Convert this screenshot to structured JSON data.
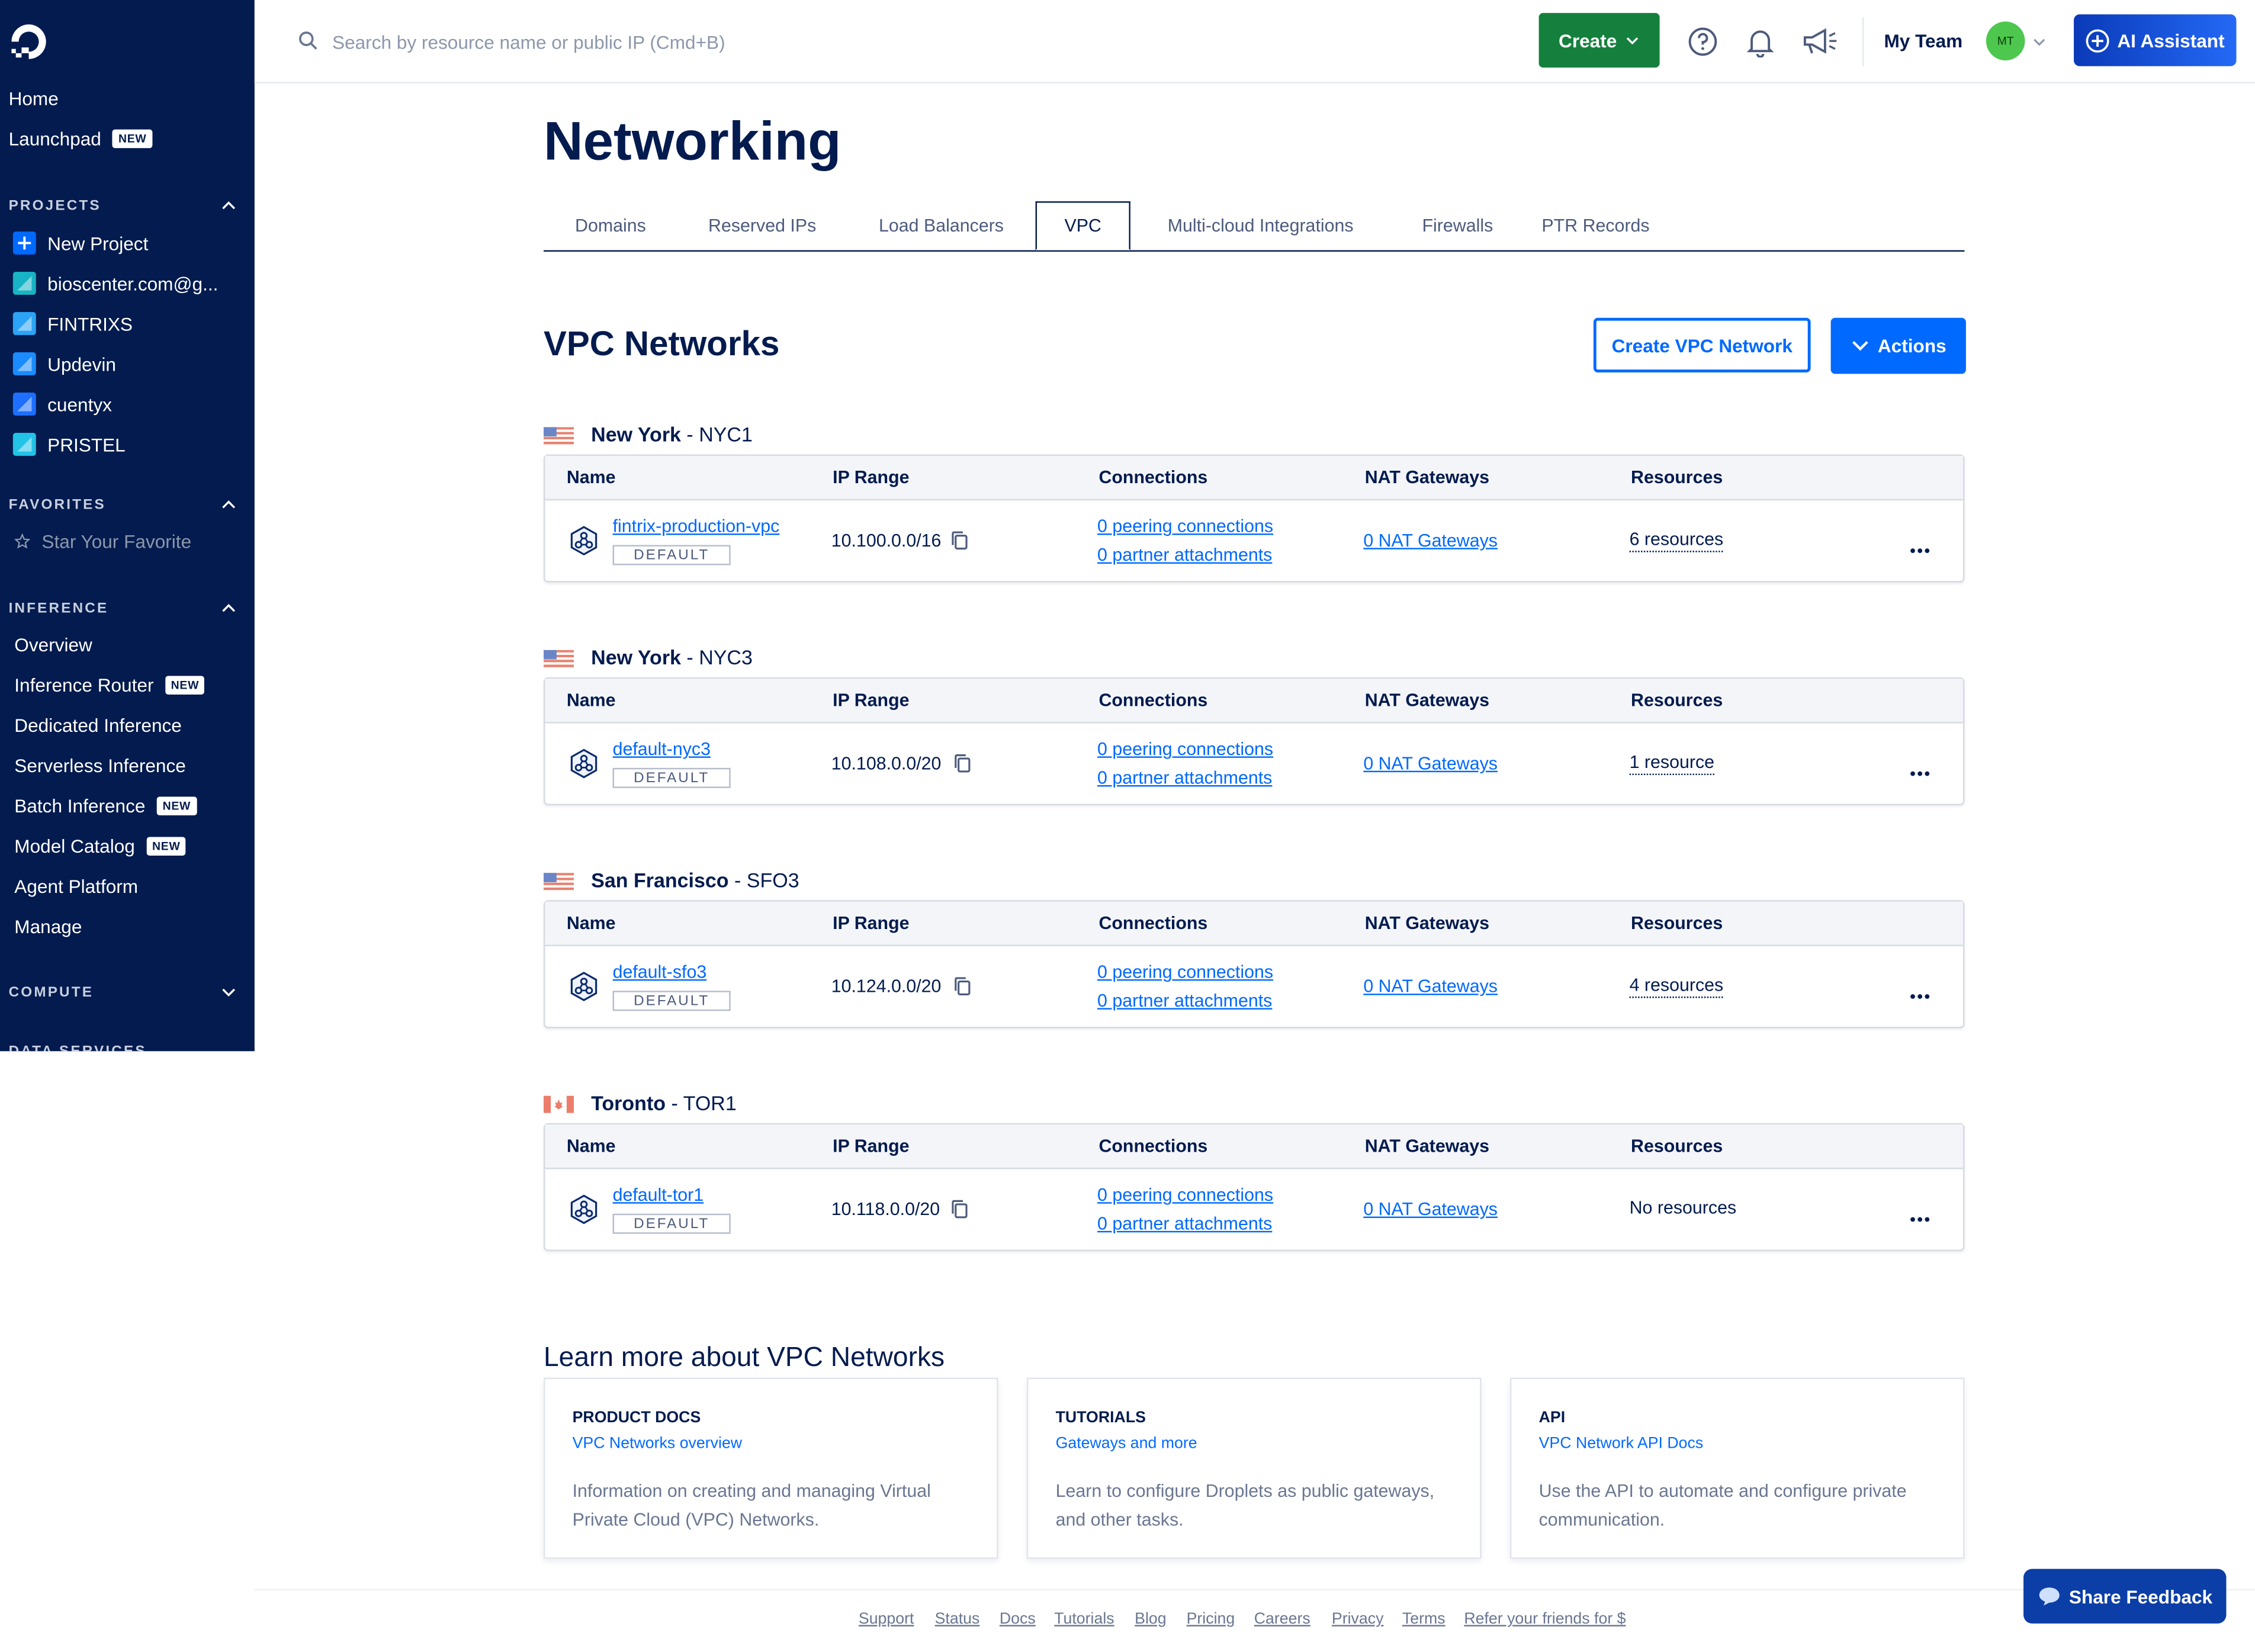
{
  "sidebar": {
    "home": "Home",
    "launchpad": "Launchpad",
    "new_badge": "NEW",
    "projects_header": "PROJECTS",
    "projects": [
      {
        "label": "New Project",
        "color": "#0069ff"
      },
      {
        "label": "bioscenter.com@g...",
        "color": "#18b3c4"
      },
      {
        "label": "FINTRIXS",
        "color": "#2ba4f5"
      },
      {
        "label": "Updevin",
        "color": "#1a8cff"
      },
      {
        "label": "cuentyx",
        "color": "#1e6fff"
      },
      {
        "label": "PRISTEL",
        "color": "#22c3e6"
      }
    ],
    "favorites_header": "FAVORITES",
    "star_favorite": "Star Your Favorite",
    "inference_header": "INFERENCE",
    "inference_items": [
      {
        "label": "Overview",
        "badge": ""
      },
      {
        "label": "Inference Router",
        "badge": "NEW"
      },
      {
        "label": "Dedicated Inference",
        "badge": ""
      },
      {
        "label": "Serverless Inference",
        "badge": ""
      },
      {
        "label": "Batch Inference",
        "badge": "NEW"
      },
      {
        "label": "Model Catalog",
        "badge": "NEW"
      },
      {
        "label": "Agent Platform",
        "badge": ""
      },
      {
        "label": "Manage",
        "badge": ""
      }
    ],
    "compute_header": "COMPUTE",
    "data_services_header": "DATA SERVICES"
  },
  "topbar": {
    "search_placeholder": "Search by resource name or public IP (Cmd+B)",
    "create_label": "Create",
    "team_label": "My Team",
    "avatar_initials": "MT",
    "ai_label": "AI Assistant"
  },
  "main": {
    "title": "Networking",
    "tabs": [
      "Domains",
      "Reserved IPs",
      "Load Balancers",
      "VPC",
      "Multi-cloud Integrations",
      "Firewalls",
      "PTR Records"
    ],
    "active_tab": "VPC",
    "section_title": "VPC Networks",
    "create_vpc_label": "Create VPC Network",
    "actions_label": "Actions",
    "columns": [
      "Name",
      "IP Range",
      "Connections",
      "NAT Gateways",
      "Resources"
    ],
    "default_tag": "DEFAULT",
    "regions": [
      {
        "city": "New York",
        "code": " - NYC1",
        "flag": "us",
        "name": "fintrix-production-vpc",
        "ip": "10.100.0.0/16",
        "peering": "0 peering connections",
        "partner": "0 partner attachments",
        "nat": "0 NAT Gateways",
        "resources": "6 resources"
      },
      {
        "city": "New York",
        "code": " - NYC3",
        "flag": "us",
        "name": "default-nyc3",
        "ip": "10.108.0.0/20",
        "peering": "0 peering connections",
        "partner": "0 partner attachments",
        "nat": "0 NAT Gateways",
        "resources": "1 resource"
      },
      {
        "city": "San Francisco",
        "code": " - SFO3",
        "flag": "us",
        "name": "default-sfo3",
        "ip": "10.124.0.0/20",
        "peering": "0 peering connections",
        "partner": "0 partner attachments",
        "nat": "0 NAT Gateways",
        "resources": "4 resources"
      },
      {
        "city": "Toronto",
        "code": " - TOR1",
        "flag": "ca",
        "name": "default-tor1",
        "ip": "10.118.0.0/20",
        "peering": "0 peering connections",
        "partner": "0 partner attachments",
        "nat": "0 NAT Gateways",
        "resources": "No resources"
      }
    ]
  },
  "learn": {
    "title": "Learn more about VPC Networks",
    "cards": [
      {
        "kind": "PRODUCT DOCS",
        "link": "VPC Networks overview",
        "desc": "Information on creating and managing Virtual Private Cloud (VPC) Networks."
      },
      {
        "kind": "TUTORIALS",
        "link": "Gateways and more",
        "desc": "Learn to configure Droplets as public gateways, and other tasks."
      },
      {
        "kind": "API",
        "link": "VPC Network API Docs",
        "desc": "Use the API to automate and configure private communication."
      }
    ]
  },
  "footer": {
    "links": [
      "Support",
      "Status",
      "Docs",
      "Tutorials",
      "Blog",
      "Pricing",
      "Careers",
      "Privacy",
      "Terms",
      "Refer your friends for $"
    ]
  },
  "feedback_label": "Share Feedback",
  "colors": {
    "sidebar_bg": "#031b4e",
    "primary": "#0069ff",
    "create_green": "#15803d"
  }
}
